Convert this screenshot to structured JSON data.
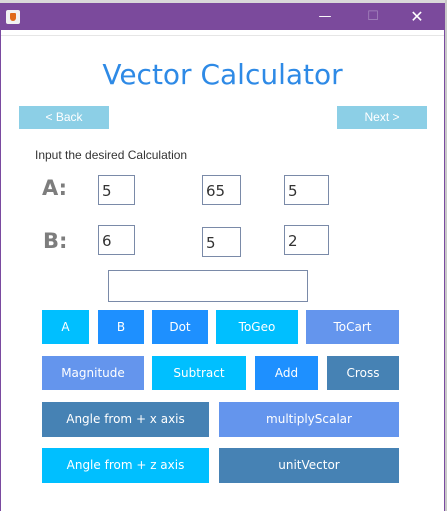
{
  "window": {
    "min_glyph": "—",
    "max_glyph": "☐",
    "close_glyph": "✕"
  },
  "title": "Vector Calculator",
  "nav": {
    "back": "< Back",
    "next": "Next >"
  },
  "prompt": "Input the desired Calculation",
  "vector_a": {
    "label": "A:",
    "values": [
      "5",
      "65",
      "5"
    ]
  },
  "vector_b": {
    "label": "B:",
    "values": [
      "6",
      "5",
      "2"
    ]
  },
  "result": "",
  "buttons": {
    "a": "A",
    "b": "B",
    "dot": "Dot",
    "togeo": "ToGeo",
    "tocart": "ToCart",
    "magnitude": "Magnitude",
    "subtract": "Subtract",
    "add": "Add",
    "cross": "Cross",
    "angle_x": "Angle from + x axis",
    "multiply_scalar": "multiplyScalar",
    "angle_z": "Angle from + z axis",
    "unit_vector": "unitVector"
  },
  "colors": {
    "titlebar": "#7b4a9c",
    "heading": "#2e8ae6",
    "nav": "#8ccfe6",
    "cyan": "#00bfff",
    "blue": "#1e90ff",
    "cornflower": "#6495ed",
    "steel": "#4682b4"
  }
}
